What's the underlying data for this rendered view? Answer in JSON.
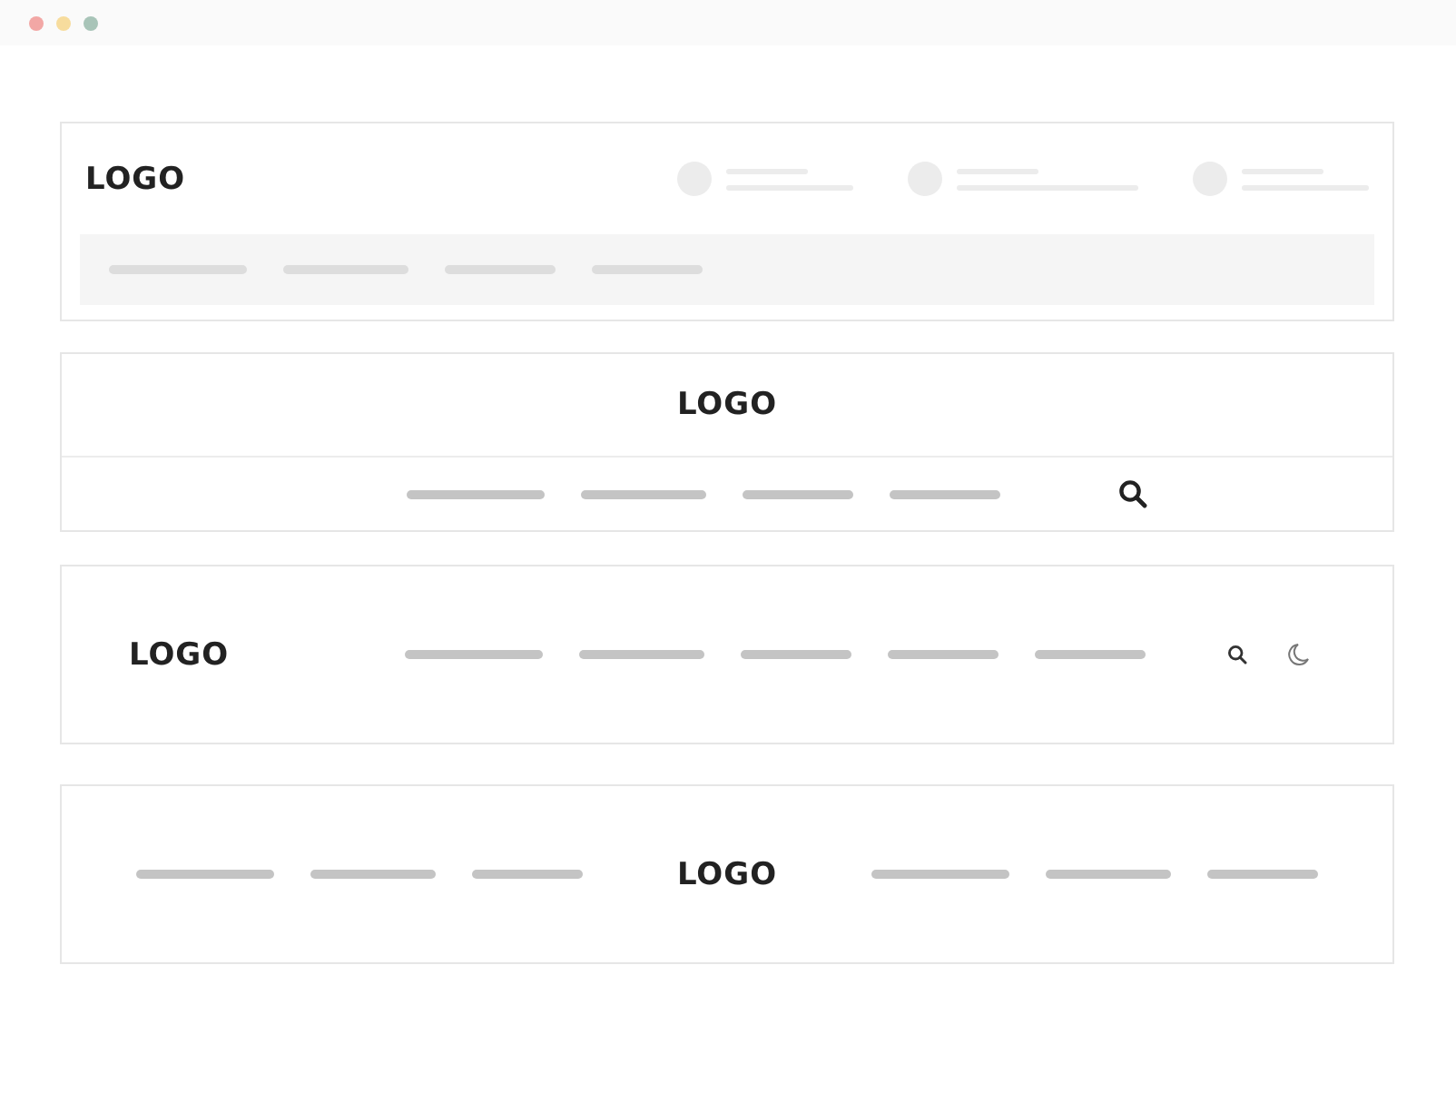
{
  "headers": [
    {
      "kind": "top-bar-with-contacts",
      "logo": "LOGO"
    },
    {
      "kind": "centered-logo",
      "logo": "LOGO"
    },
    {
      "kind": "inline",
      "logo": "LOGO"
    },
    {
      "kind": "split",
      "logo": "LOGO"
    }
  ]
}
